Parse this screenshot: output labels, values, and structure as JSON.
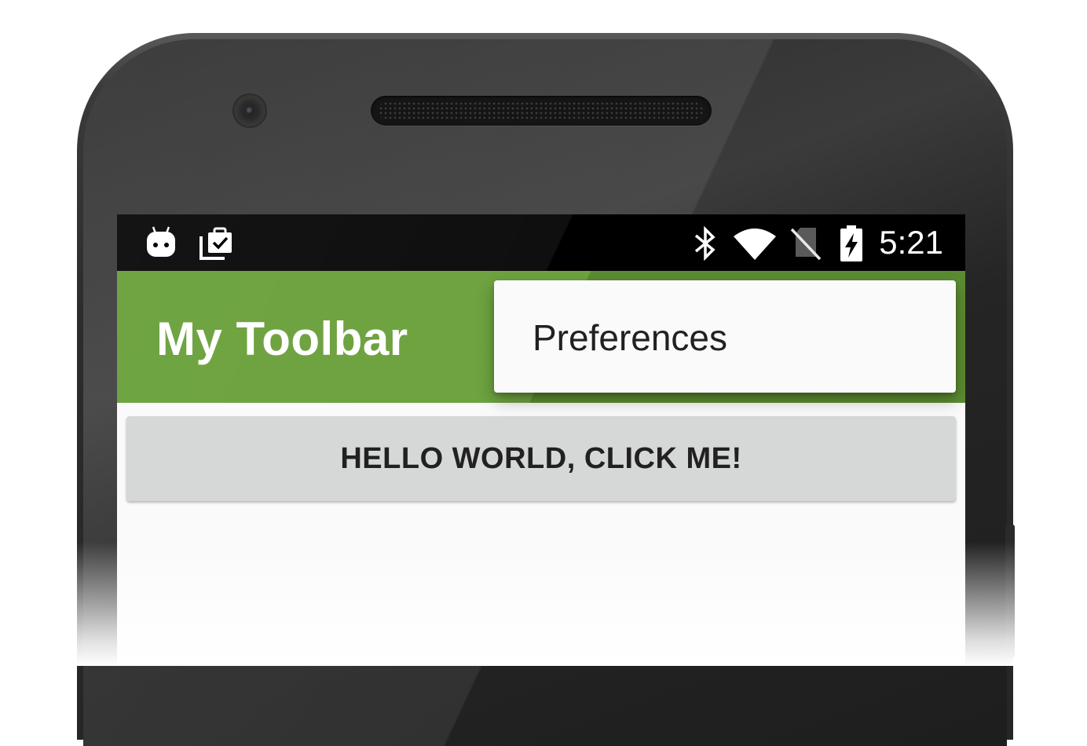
{
  "status_bar": {
    "time": "5:21",
    "icons": [
      "android-debug-icon",
      "clipboard-check-icon",
      "bluetooth-icon",
      "wifi-icon",
      "no-sim-icon",
      "battery-charging-icon"
    ]
  },
  "toolbar": {
    "title": "My Toolbar",
    "color": "#689f38"
  },
  "overflow_menu": {
    "items": [
      {
        "label": "Preferences"
      }
    ]
  },
  "main": {
    "button_label": "HELLO WORLD, CLICK ME!",
    "button_color": "#d6d7d7"
  }
}
